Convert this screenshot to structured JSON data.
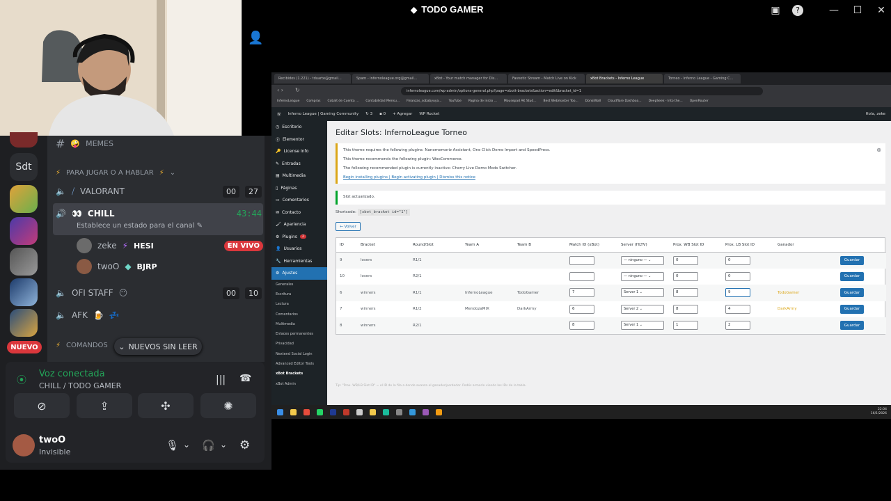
{
  "window": {
    "title": "TODO GAMER",
    "controls": [
      "inbox-icon",
      "help-icon",
      "minimize",
      "maximize",
      "close"
    ]
  },
  "discord": {
    "servers": [
      {
        "label": "Sdt"
      }
    ],
    "new_badge": "NUEVO",
    "channels": {
      "memes": "MEMES",
      "category_jugar": "PARA JUGAR O A HABLAR",
      "valorant": "VALORANT",
      "valorant_counts": [
        "00",
        "27"
      ],
      "chill": "CHILL",
      "chill_timer": "43:44",
      "chill_status": "Establece un estado para el canal",
      "users": [
        {
          "name": "zeke",
          "tag": "HESI",
          "live": "EN VIVO"
        },
        {
          "name": "twoO",
          "tag": "BJRP"
        }
      ],
      "ofi_staff": "OFI STAFF",
      "ofi_counts": [
        "00",
        "10"
      ],
      "afk": "AFK",
      "comandos": "COMANDOS",
      "unread_pill": "NUEVOS SIN LEER"
    },
    "voice": {
      "status": "Voz conectada",
      "channel": "CHILL / TODO GAMER"
    },
    "user": {
      "name": "twoO",
      "status": "Invisible"
    }
  },
  "browser": {
    "tabs": [
      "Recibidos (1.221) - tduarte@gmail...",
      "Spam - infernoleague.org@gmail...",
      "xBot - Your match manager for Dis...",
      "Fasnotic Stream - Match Live on Kick",
      "xBot Brackets - Inferno League",
      "Torneo - Inferno League - Gaming C..."
    ],
    "url": "infernoleague.com/wp-admin/options-general.php?page=xbott-brackets&action=edit&bracket_id=1",
    "bookmarks": [
      "InfernoLeague",
      "Compras",
      "Cobalt de Cuenta ...",
      "Contabilidad Mensu...",
      "Finanzas_sobabyuya...",
      "YouTube",
      "Pagina de inicio ...",
      "Mousepad AK Stud...",
      "Best Webmaster Too...",
      "DonkiWall",
      "Cloudflare Dashboa...",
      "DeepSeek - Into the...",
      "OpenRouter"
    ],
    "wpbar": {
      "site": "Inferno League | Gaming Community",
      "updates": "3",
      "comments": "0",
      "add": "Agregar",
      "rocket": "WP Rocket",
      "greeting": "Hola, zeke"
    }
  },
  "wp": {
    "menu": [
      "Escritorio",
      "Elementor",
      "License Info",
      "Entradas",
      "Multimedia",
      "Páginas",
      "Comentarios",
      "Contacto",
      "Apariencia",
      "Plugins",
      "Usuarios",
      "Herramientas",
      "Ajustes"
    ],
    "plugins_badge": "2",
    "submenu": [
      "Generales",
      "Escritura",
      "Lectura",
      "Comentarios",
      "Multimedia",
      "Enlaces permanentes",
      "Privacidad",
      "Nextend Social Login",
      "Advanced Editor Tools",
      "xBot Brackets",
      "xBot Admin"
    ],
    "page_title": "Editar Slots: InfernoLeague Torneo",
    "notice_lines": [
      "This theme requires the following plugins: Nanomemoriz Assistant, One Click Demo Import and SpeedPress.",
      "This theme recommends the following plugin: WooCommerce.",
      "The following recommended plugin is currently inactive: Cherry Live Demo Mods Switcher.",
      "Begin installing plugins | Begin activating plugin | Dismiss this notice"
    ],
    "success": "Slot actualizado.",
    "shortcode_label": "Shortcode:",
    "shortcode": "[xbot_bracket id=\"1\"]",
    "back": "← Volver",
    "columns": [
      "ID",
      "Bracket",
      "Round/Slot",
      "Team A",
      "Team B",
      "Match ID (xBot)",
      "Server (HLTV)",
      "Prox. WB Slot ID",
      "Prox. LB Slot ID",
      "Ganador"
    ],
    "rows": [
      {
        "id": "9",
        "bracket": "losers",
        "round": "R1/1",
        "team_a": "",
        "team_b": "",
        "match": "",
        "server": "— ninguno —",
        "wb": "0",
        "lb": "0",
        "winner": "",
        "save": "Guardar"
      },
      {
        "id": "10",
        "bracket": "losers",
        "round": "R2/1",
        "team_a": "",
        "team_b": "",
        "match": "",
        "server": "— ninguno —",
        "wb": "0",
        "lb": "0",
        "winner": "",
        "save": "Guardar"
      },
      {
        "id": "6",
        "bracket": "winners",
        "round": "R1/1",
        "team_a": "InfernoLeague",
        "team_b": "TodoGamer",
        "match": "7",
        "server": "Server 1",
        "wb": "8",
        "lb": "9",
        "winner": "TodoGamer",
        "save": "Guardar"
      },
      {
        "id": "7",
        "bracket": "winners",
        "round": "R1/2",
        "team_a": "MendozaMIX",
        "team_b": "DarkArmy",
        "match": "6",
        "server": "Server 2",
        "wb": "8",
        "lb": "4",
        "winner": "DarkArmy",
        "save": "Guardar"
      },
      {
        "id": "8",
        "bracket": "winners",
        "round": "R2/1",
        "team_a": "",
        "team_b": "",
        "match": "8",
        "server": "Server 1",
        "wb": "1",
        "lb": "2",
        "winner": "",
        "save": "Guardar"
      }
    ],
    "footnote": "Tip: \"Prox. WB/LB Slot ID\" = el ID de la fila a donde avanza el ganador/perdedor. Podés armarlo viendo los IDs de la tabla."
  },
  "taskbar": {
    "time": "22:04",
    "date": "16/1/2026"
  }
}
